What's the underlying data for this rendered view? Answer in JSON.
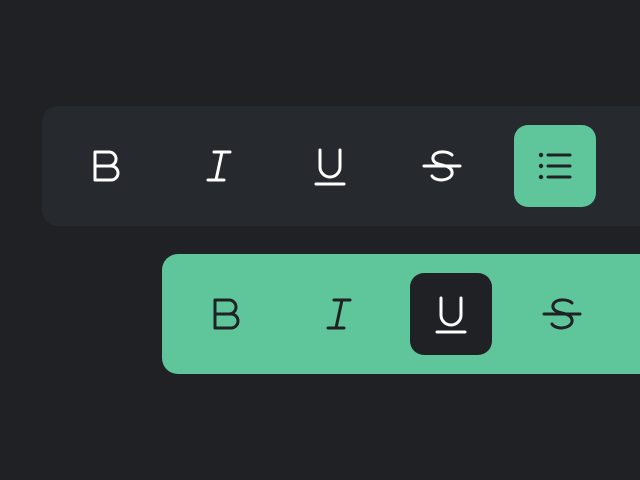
{
  "colors": {
    "background": "#1f2125",
    "toolbar_dark": "#26292d",
    "accent_green": "#5fc69b",
    "icon_light": "#ffffff",
    "icon_dark": "#1f2125"
  },
  "toolbar_dark": {
    "buttons": [
      {
        "name": "bold",
        "icon": "bold-icon",
        "active": false
      },
      {
        "name": "italic",
        "icon": "italic-icon",
        "active": false
      },
      {
        "name": "underline",
        "icon": "underline-icon",
        "active": false
      },
      {
        "name": "strikethrough",
        "icon": "strikethrough-icon",
        "active": false
      },
      {
        "name": "bullet-list",
        "icon": "list-icon",
        "active": true
      }
    ]
  },
  "toolbar_green": {
    "buttons": [
      {
        "name": "bold",
        "icon": "bold-icon",
        "active": false
      },
      {
        "name": "italic",
        "icon": "italic-icon",
        "active": false
      },
      {
        "name": "underline",
        "icon": "underline-icon",
        "active": true
      },
      {
        "name": "strikethrough",
        "icon": "strikethrough-icon",
        "active": false
      }
    ]
  }
}
